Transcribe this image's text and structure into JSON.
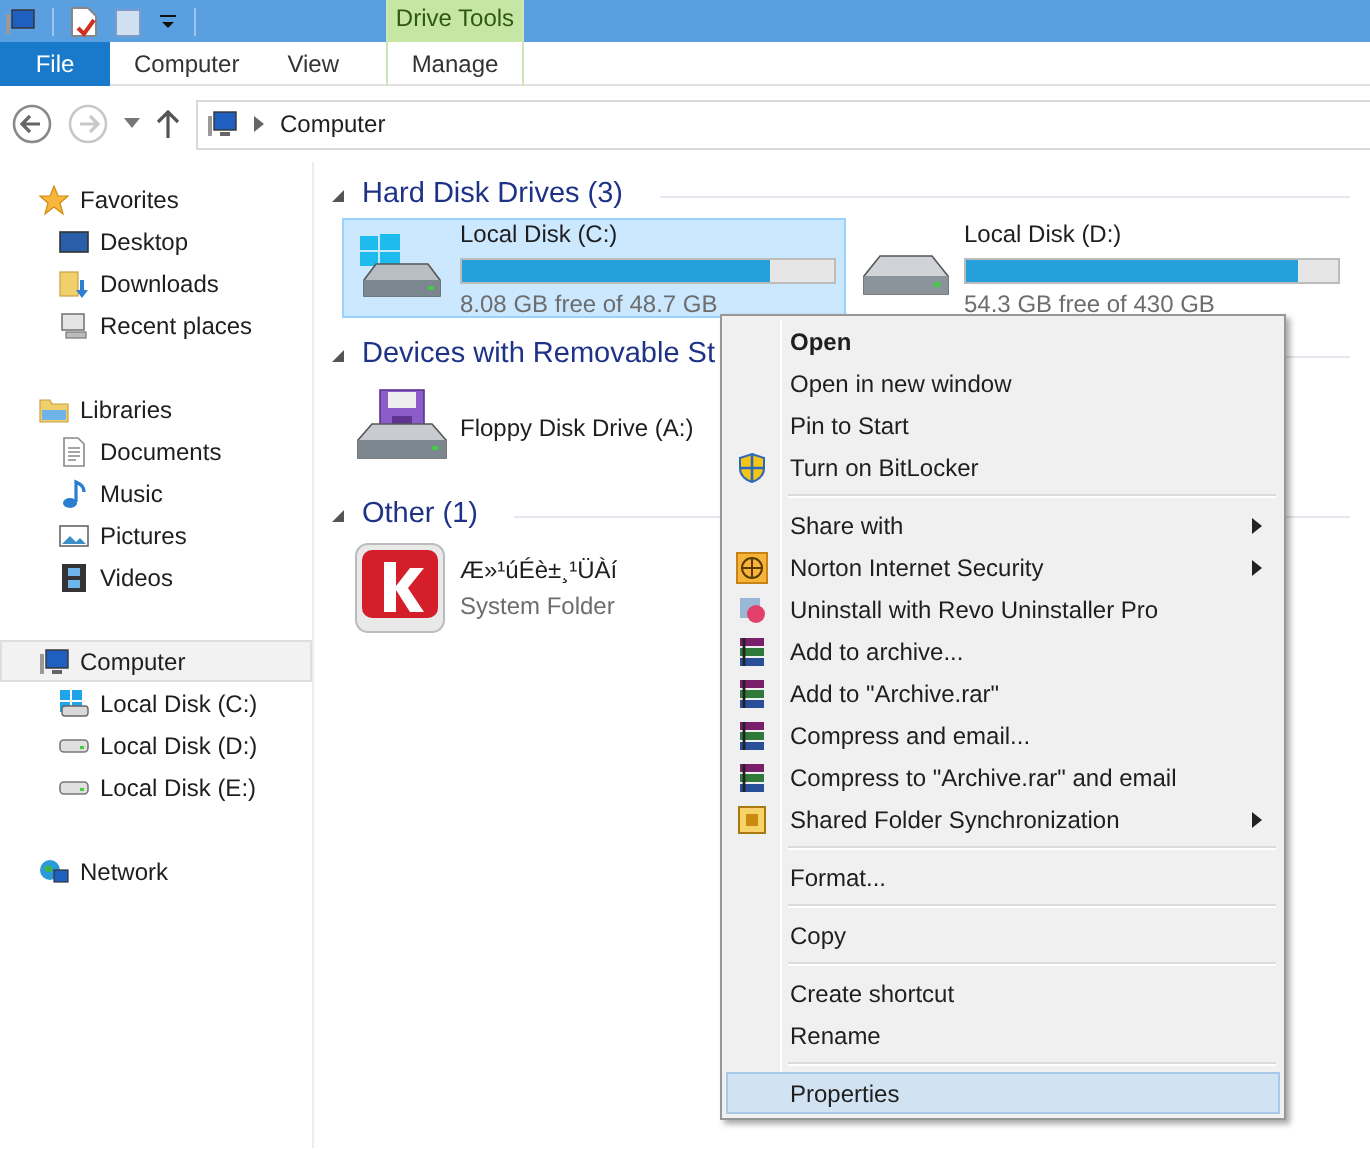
{
  "ribbon": {
    "context_group": "Drive Tools",
    "tabs": [
      {
        "label": "File",
        "kind": "file"
      },
      {
        "label": "Computer",
        "kind": "tab"
      },
      {
        "label": "View",
        "kind": "tab"
      },
      {
        "label": "Manage",
        "kind": "context"
      }
    ]
  },
  "address": {
    "path": "Computer",
    "forward_disabled": true
  },
  "sidebar": {
    "groups": [
      {
        "label": "Favorites",
        "kind": "favorites",
        "selected": false,
        "children": [
          {
            "label": "Desktop",
            "kind": "desktop",
            "selected": false
          },
          {
            "label": "Downloads",
            "kind": "downloads",
            "selected": false
          },
          {
            "label": "Recent places",
            "kind": "recent",
            "selected": false
          }
        ]
      },
      {
        "label": "Libraries",
        "kind": "libraries",
        "selected": false,
        "children": [
          {
            "label": "Documents",
            "kind": "documents",
            "selected": false
          },
          {
            "label": "Music",
            "kind": "music",
            "selected": false
          },
          {
            "label": "Pictures",
            "kind": "pictures",
            "selected": false
          },
          {
            "label": "Videos",
            "kind": "videos",
            "selected": false
          }
        ]
      },
      {
        "label": "Computer",
        "kind": "computer",
        "selected": true,
        "children": [
          {
            "label": "Local Disk (C:)",
            "kind": "systemdisk",
            "selected": false
          },
          {
            "label": "Local Disk (D:)",
            "kind": "disk",
            "selected": false
          },
          {
            "label": "Local Disk (E:)",
            "kind": "disk",
            "selected": false
          }
        ]
      },
      {
        "label": "Network",
        "kind": "network",
        "selected": false
      }
    ]
  },
  "content": {
    "groups": [
      {
        "title": "Hard Disk Drives (3)",
        "expanded": true,
        "items": [
          {
            "kind": "systemdisk",
            "name": "Local Disk (C:)",
            "selected": true,
            "level": 0.83,
            "detail": "8.08 GB free of 48.7 GB"
          },
          {
            "kind": "disk",
            "name": "Local Disk (D:)",
            "selected": false,
            "level": 0.89,
            "detail": "54.3 GB free of 430 GB"
          }
        ]
      },
      {
        "title": "Devices with Removable St",
        "expanded": true,
        "items": [
          {
            "kind": "floppy",
            "name": "Floppy Disk Drive (A:)",
            "selected": false
          }
        ]
      },
      {
        "title": "Other (1)",
        "expanded": true,
        "items": [
          {
            "kind": "app",
            "name": "Æ»¹úÉè±¸¹ÜÀí",
            "detail": "System Folder",
            "selected": false
          }
        ]
      }
    ]
  },
  "context_menu": [
    {
      "kind": "plain",
      "label": "Open",
      "default": true,
      "selected": false
    },
    {
      "kind": "plain",
      "label": "Open in new window",
      "selected": false
    },
    {
      "kind": "plain",
      "label": "Pin to Start",
      "selected": false
    },
    {
      "kind": "shield",
      "label": "Turn on BitLocker",
      "selected": false
    },
    {
      "kind": "separator"
    },
    {
      "kind": "plain",
      "label": "Share with",
      "submenu": true,
      "selected": false
    },
    {
      "kind": "norton",
      "label": "Norton Internet Security",
      "submenu": true,
      "selected": false
    },
    {
      "kind": "revo",
      "label": "Uninstall with Revo Uninstaller Pro",
      "selected": false
    },
    {
      "kind": "winrar",
      "label": "Add to archive...",
      "selected": false
    },
    {
      "kind": "winrar",
      "label": "Add to \"Archive.rar\"",
      "selected": false
    },
    {
      "kind": "winrar",
      "label": "Compress and email...",
      "selected": false
    },
    {
      "kind": "winrar",
      "label": "Compress to \"Archive.rar\" and email",
      "selected": false
    },
    {
      "kind": "sync",
      "label": "Shared Folder Synchronization",
      "submenu": true,
      "selected": false
    },
    {
      "kind": "separator"
    },
    {
      "kind": "plain",
      "label": "Format...",
      "selected": false
    },
    {
      "kind": "separator"
    },
    {
      "kind": "plain",
      "label": "Copy",
      "selected": false
    },
    {
      "kind": "separator"
    },
    {
      "kind": "plain",
      "label": "Create shortcut",
      "selected": false
    },
    {
      "kind": "plain",
      "label": "Rename",
      "selected": false
    },
    {
      "kind": "separator"
    },
    {
      "kind": "plain",
      "label": "Properties",
      "selected": true
    }
  ]
}
